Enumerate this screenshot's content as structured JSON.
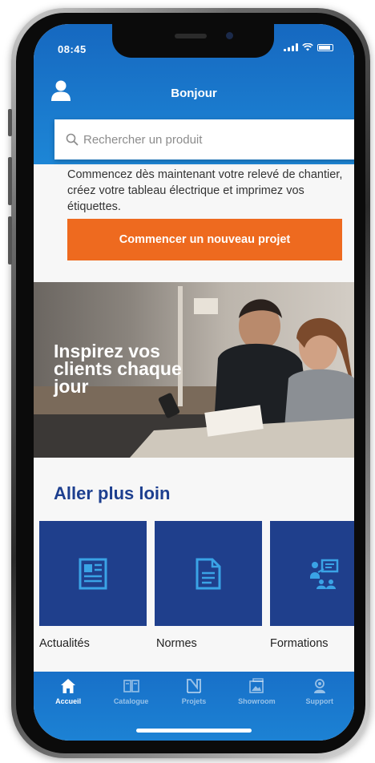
{
  "status_bar": {
    "time": "08:45"
  },
  "header": {
    "greeting": "Bonjour"
  },
  "search": {
    "placeholder": "Rechercher un produit"
  },
  "intro": {
    "text": "Commencez dès maintenant votre relevé de chantier, créez votre tableau électrique et imprimez vos étiquettes."
  },
  "cta": {
    "label": "Commencer un nouveau projet"
  },
  "banner": {
    "text": "Inspirez vos clients chaque jour"
  },
  "section": {
    "title": "Aller plus loin",
    "cards": [
      {
        "label": "Actualités",
        "icon": "news-icon"
      },
      {
        "label": "Normes",
        "icon": "document-icon"
      },
      {
        "label": "Formations",
        "icon": "training-icon"
      }
    ]
  },
  "tabbar": {
    "tabs": [
      {
        "label": "Accueil",
        "icon": "home-icon",
        "active": true
      },
      {
        "label": "Catalogue",
        "icon": "catalogue-icon",
        "active": false
      },
      {
        "label": "Projets",
        "icon": "projects-icon",
        "active": false
      },
      {
        "label": "Showroom",
        "icon": "showroom-icon",
        "active": false
      },
      {
        "label": "Support",
        "icon": "support-icon",
        "active": false
      }
    ]
  },
  "colors": {
    "brand_blue": "#1d86d6",
    "dark_blue": "#1f3f8c",
    "accent_orange": "#ee6a1f"
  }
}
